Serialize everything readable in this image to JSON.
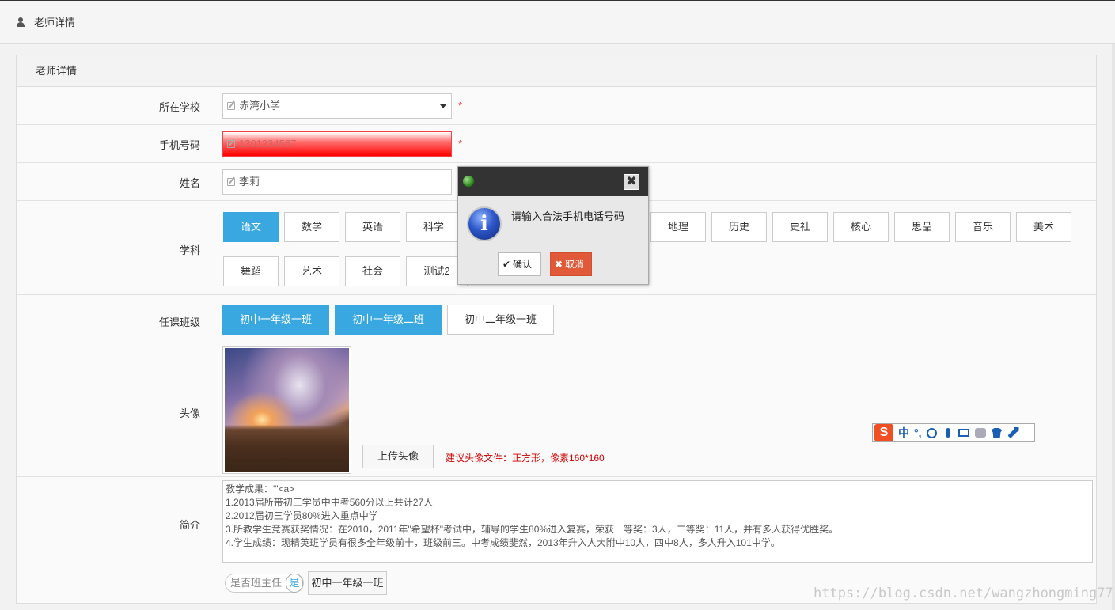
{
  "header": {
    "title": "老师详情"
  },
  "panel": {
    "title": "老师详情"
  },
  "form": {
    "school": {
      "label": "所在学校",
      "value": "赤湾小学",
      "required": "*"
    },
    "phone": {
      "label": "手机号码",
      "value": "1301234567",
      "required": "*"
    },
    "name": {
      "label": "姓名",
      "value": "李莉"
    },
    "subject": {
      "label": "学科",
      "items": [
        "语文",
        "数学",
        "英语",
        "科学",
        "地理",
        "历史",
        "史社",
        "核心",
        "思品",
        "音乐",
        "美术",
        "舞蹈",
        "艺术",
        "社会",
        "测试2"
      ],
      "active": "语文"
    },
    "classes": {
      "label": "任课班级",
      "items": [
        "初中一年级一班",
        "初中一年级二班",
        "初中二年级一班"
      ]
    },
    "avatar": {
      "label": "头像",
      "upload_label": "上传头像",
      "hint": "建议头像文件：正方形，像素160*160"
    },
    "intro": {
      "label": "简介",
      "lines": [
        "教学成果：'\"<a>",
        "1.2013届所带初三学员中中考560分以上共计27人",
        "2.2012届初三学员80%进入重点中学",
        "3.所教学生竞赛获奖情况：在2010，2011年\"希望杯\"考试中，辅导的学生80%进入复赛，荣获一等奖：3人，二等奖：11人，并有多人获得优胜奖。",
        "4.学生成绩：现精英班学员有很多全年级前十，班级前三。中考成绩斐然，2013年升入人大附中10人，四中8人，多人升入101中学。"
      ]
    },
    "head_teacher": {
      "label": "是否班主任",
      "knob": "是",
      "class": "初中一年级一班"
    }
  },
  "dialog": {
    "message": "请输入合法手机电话号码",
    "ok_label": "确认",
    "cancel_label": "取消",
    "close_glyph": "✖"
  },
  "ime": {
    "logo": "S",
    "mode": "中",
    "punct": "°,"
  },
  "watermark": "https://blog.csdn.net/wangzhongming77"
}
